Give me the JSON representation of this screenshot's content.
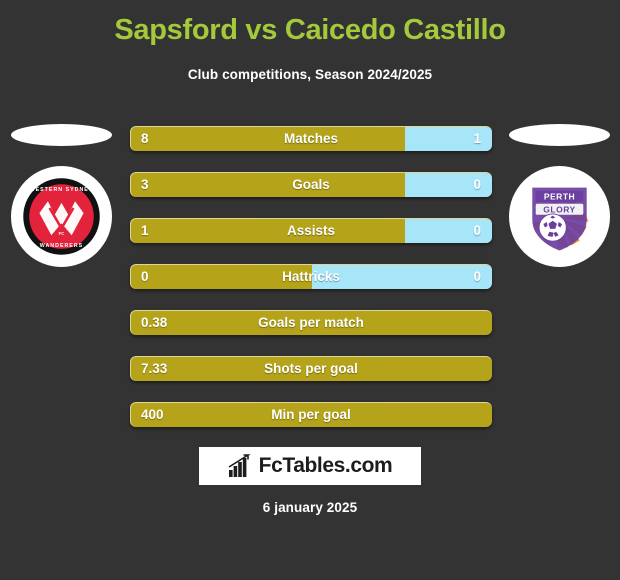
{
  "header": {
    "title": "Sapsford vs Caicedo Castillo",
    "subtitle": "Club competitions, Season 2024/2025",
    "title_color": "#a4c93b"
  },
  "teams": {
    "home": {
      "crest_name": "western-sydney-wanderers-crest",
      "crest_top_text": "WESTERN SYDNEY",
      "crest_bottom_text": "WANDERERS",
      "crest_mid_text": "FC",
      "crest_colors": {
        "ring": "#111111",
        "field": "#e3233c",
        "outline": "#ffffff"
      }
    },
    "away": {
      "crest_name": "perth-glory-crest",
      "crest_top_text": "PERTH",
      "crest_bottom_text": "GLORY",
      "crest_colors": {
        "shield": "#6b3fa0",
        "rays": "#f08a1e",
        "ball": "#ffffff",
        "outline": "#ffffff"
      }
    }
  },
  "colors": {
    "background": "#333333",
    "home_bar": "#b5a31a",
    "away_bar": "#a7e5f9",
    "text": "#ffffff"
  },
  "stats": [
    {
      "label": "Matches",
      "home": "8",
      "away": "1",
      "home_pct": 76,
      "split": true
    },
    {
      "label": "Goals",
      "home": "3",
      "away": "0",
      "home_pct": 76,
      "split": true
    },
    {
      "label": "Assists",
      "home": "1",
      "away": "0",
      "home_pct": 76,
      "split": true
    },
    {
      "label": "Hattricks",
      "home": "0",
      "away": "0",
      "home_pct": 50,
      "split": true
    },
    {
      "label": "Goals per match",
      "home": "0.38",
      "away": "",
      "home_pct": 100,
      "split": false
    },
    {
      "label": "Shots per goal",
      "home": "7.33",
      "away": "",
      "home_pct": 100,
      "split": false
    },
    {
      "label": "Min per goal",
      "home": "400",
      "away": "",
      "home_pct": 100,
      "split": false
    }
  ],
  "footer": {
    "watermark_text": "FcTables.com",
    "watermark_icon": "bar-chart-arrow-icon",
    "date": "6 january 2025"
  }
}
